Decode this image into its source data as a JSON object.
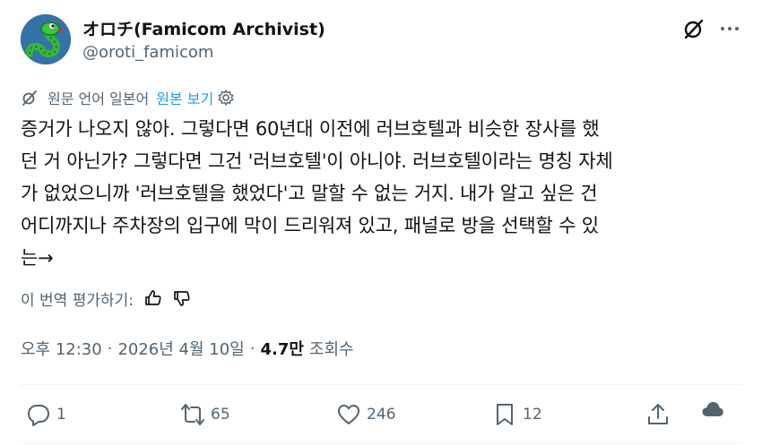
{
  "author": {
    "name": "オロチ(Famicom Archivist)",
    "handle": "@oroti_famicom"
  },
  "translation": {
    "notice": "원문 언어 일본어",
    "show_original": "원본 보기"
  },
  "tweet": {
    "text": "증거가 나오지 않아. 그렇다면 60년대 이전에 러브호텔과 비슷한 장사를 했\n던 거 아닌가? 그렇다면 그건 '러브호텔'이 아니야. 러브호텔이라는 명칭 자체\n가 없었으니까 '러브호텔을 했었다'고 말할 수 없는 거지. 내가 알고 싶은 건\n어디까지나 주차장의 입구에 막이 드리워져 있고, 패널로 방을 선택할 수 있\n는→"
  },
  "rate": {
    "label": "이 번역 평가하기:"
  },
  "meta": {
    "time": "오후 12:30",
    "date": "2026년 4월 10일",
    "views": "4.7만",
    "views_label": "조회수"
  },
  "actions": {
    "replies": "1",
    "reposts": "65",
    "likes": "246",
    "bookmarks": "12"
  }
}
